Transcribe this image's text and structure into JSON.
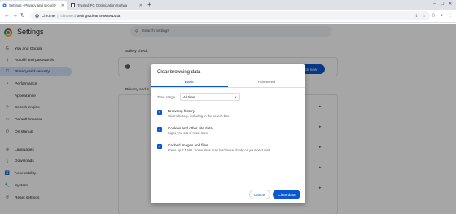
{
  "tabs": [
    {
      "title": "Settings - Privacy and security",
      "icon": "gear-icon",
      "active": true
    },
    {
      "title": "Trusted PC Optimization Softwa",
      "icon": "app-favicon-icon",
      "active": false
    }
  ],
  "toolbar": {
    "url_prefix": "Chrome",
    "url_scheme": "chrome://",
    "url_path": "settings/clearBrowserData"
  },
  "header": {
    "title": "Settings",
    "search_placeholder": "Search settings"
  },
  "sidebar": {
    "items": [
      {
        "label": "You and Google",
        "icon": "google-icon"
      },
      {
        "label": "Autofill and passwords",
        "icon": "key-icon"
      },
      {
        "label": "Privacy and security",
        "icon": "shield-icon",
        "selected": true
      },
      {
        "label": "Performance",
        "icon": "speedometer-icon"
      },
      {
        "label": "Appearance",
        "icon": "palette-icon"
      },
      {
        "label": "Search engine",
        "icon": "search-icon"
      },
      {
        "label": "Default browser",
        "icon": "browser-icon"
      },
      {
        "label": "On startup",
        "icon": "power-icon"
      },
      {
        "label": "Languages",
        "icon": "globe-icon"
      },
      {
        "label": "Downloads",
        "icon": "download-icon"
      },
      {
        "label": "Accessibility",
        "icon": "accessibility-icon"
      },
      {
        "label": "System",
        "icon": "wrench-icon"
      },
      {
        "label": "Reset settings",
        "icon": "reset-icon"
      }
    ]
  },
  "main": {
    "safety_check_label": "Safety check",
    "privacy_label": "Privacy and s",
    "check_now_label": "ck now"
  },
  "dialog": {
    "title": "Clear browsing data",
    "tab_basic": "Basic",
    "tab_advanced": "Advanced",
    "time_range_label": "Time range",
    "time_range_value": "All time",
    "options": [
      {
        "title": "Browsing history",
        "desc": "Clears history, including in the search box",
        "checked": true
      },
      {
        "title": "Cookies and other site data",
        "desc": "Signs you out of most sites.",
        "checked": true
      },
      {
        "title": "Cached images and files",
        "desc": "Frees up 7.9 MB. Some sites may load more slowly on your next visit.",
        "checked": true
      }
    ],
    "cancel_label": "Cancel",
    "clear_label": "Clear data"
  },
  "colors": {
    "accent": "#0b57d0",
    "selected_nav": "#d3e3fd"
  }
}
